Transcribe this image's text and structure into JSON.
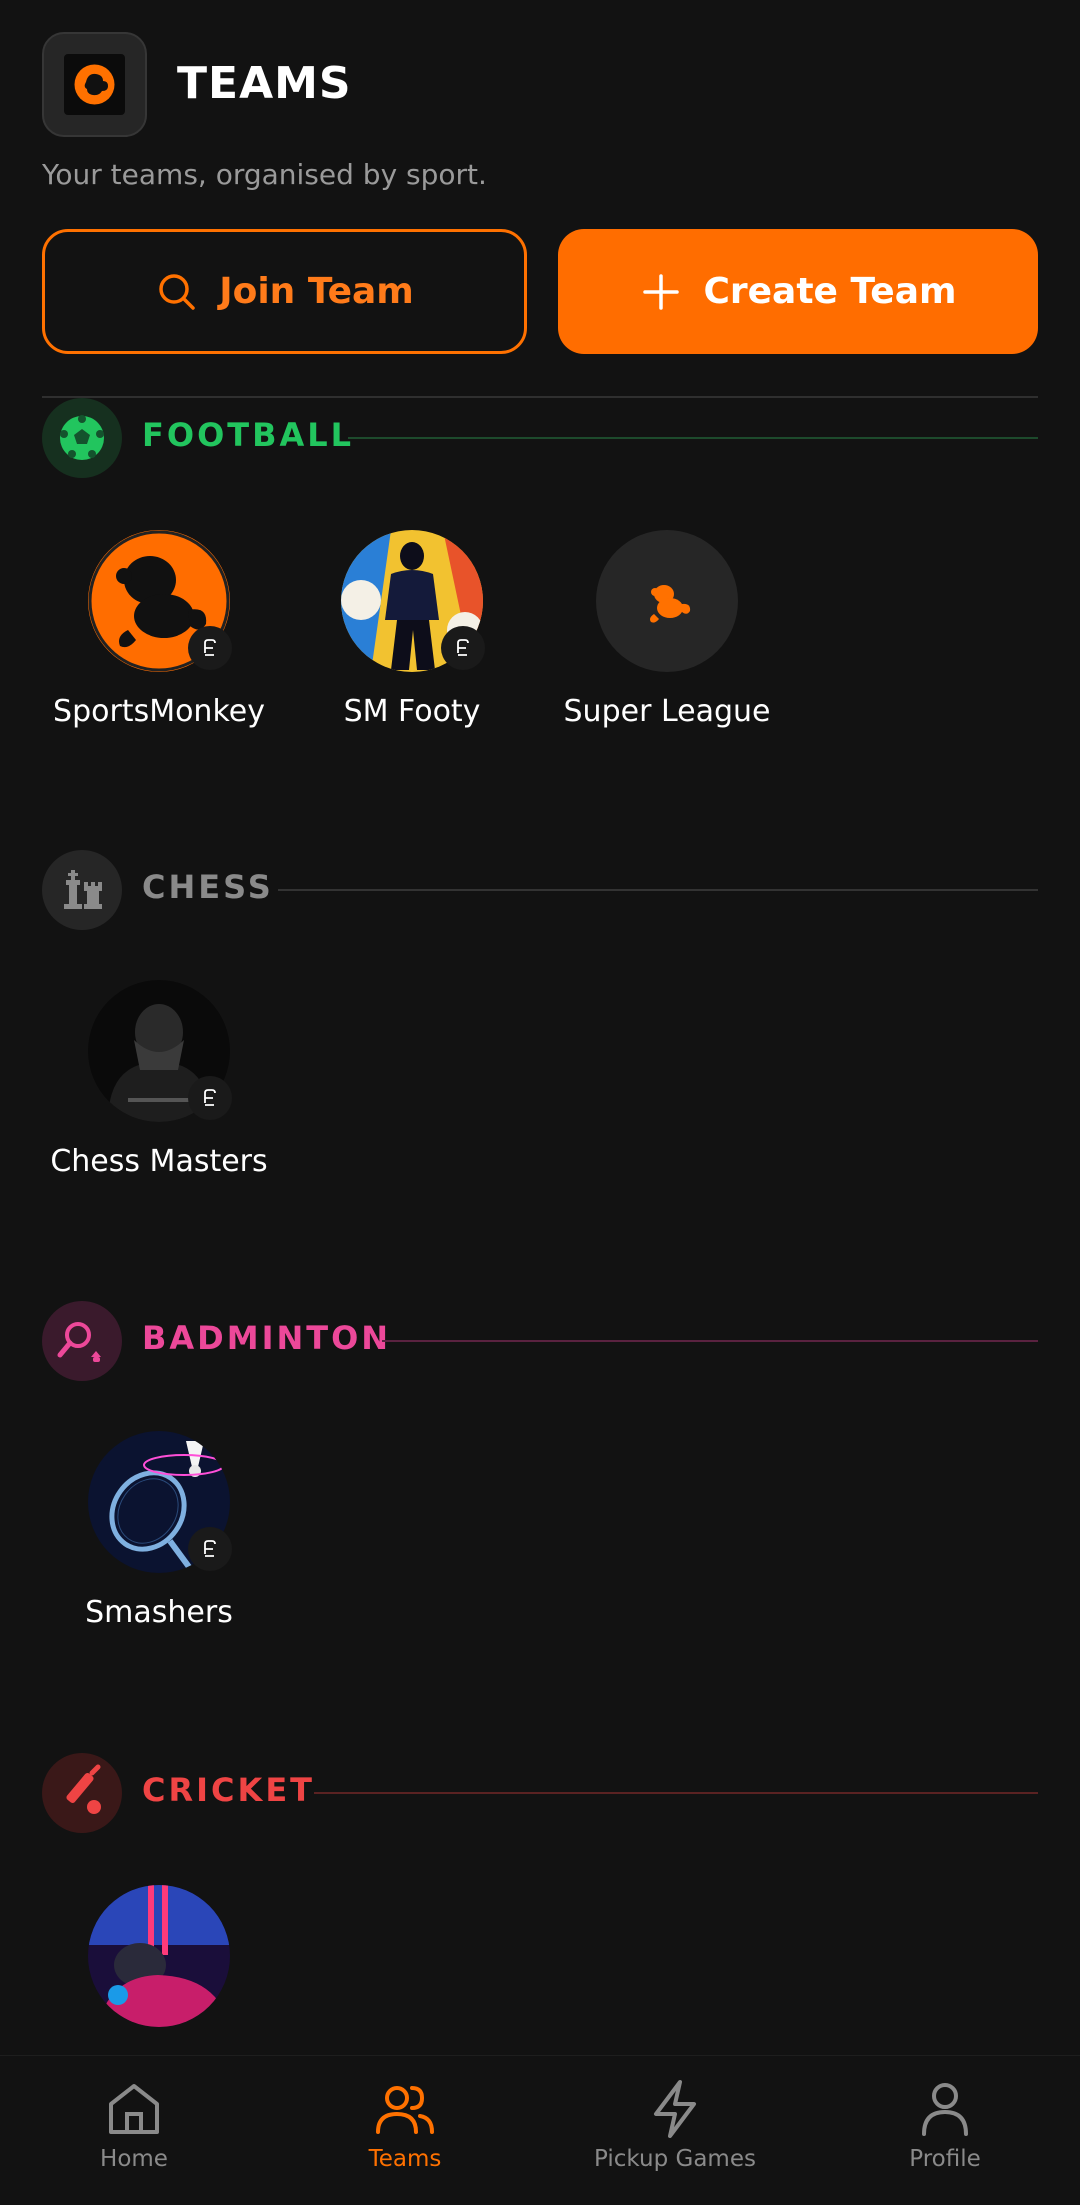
{
  "header": {
    "title": "TEAMS",
    "subtitle": "Your teams, organised by sport."
  },
  "actions": {
    "join_label": "Join Team",
    "create_label": "Create Team"
  },
  "colors": {
    "accent": "#ff6d00",
    "football": "#22c55e",
    "chess": "#8a8a8a",
    "badminton": "#ec4899",
    "cricket": "#ef4444"
  },
  "sections": [
    {
      "title": "FOOTBALL",
      "icon": "soccer-ball-icon",
      "teams": [
        {
          "name": "SportsMonkey",
          "avatar": "monkey-logo-orange",
          "badge": "edit-icon"
        },
        {
          "name": "SM Footy",
          "avatar": "footballer-art",
          "badge": "edit-icon"
        },
        {
          "name": "Super League",
          "avatar": "monkey-logo-small"
        }
      ]
    },
    {
      "title": "CHESS",
      "icon": "chess-pieces-icon",
      "teams": [
        {
          "name": "Chess Masters",
          "avatar": "chess-player-photo",
          "badge": "edit-icon"
        }
      ]
    },
    {
      "title": "BADMINTON",
      "icon": "badminton-racket-icon",
      "teams": [
        {
          "name": "Smashers",
          "avatar": "racket-shuttle-art",
          "badge": "edit-icon"
        }
      ]
    },
    {
      "title": "CRICKET",
      "icon": "cricket-bat-icon",
      "teams": [
        {
          "name": "",
          "avatar": "cricket-neon-art"
        }
      ]
    }
  ],
  "nav": [
    {
      "label": "Home",
      "icon": "home-icon"
    },
    {
      "label": "Teams",
      "icon": "users-icon",
      "active": true
    },
    {
      "label": "Pickup Games",
      "icon": "lightning-icon"
    },
    {
      "label": "Profile",
      "icon": "user-icon"
    }
  ]
}
